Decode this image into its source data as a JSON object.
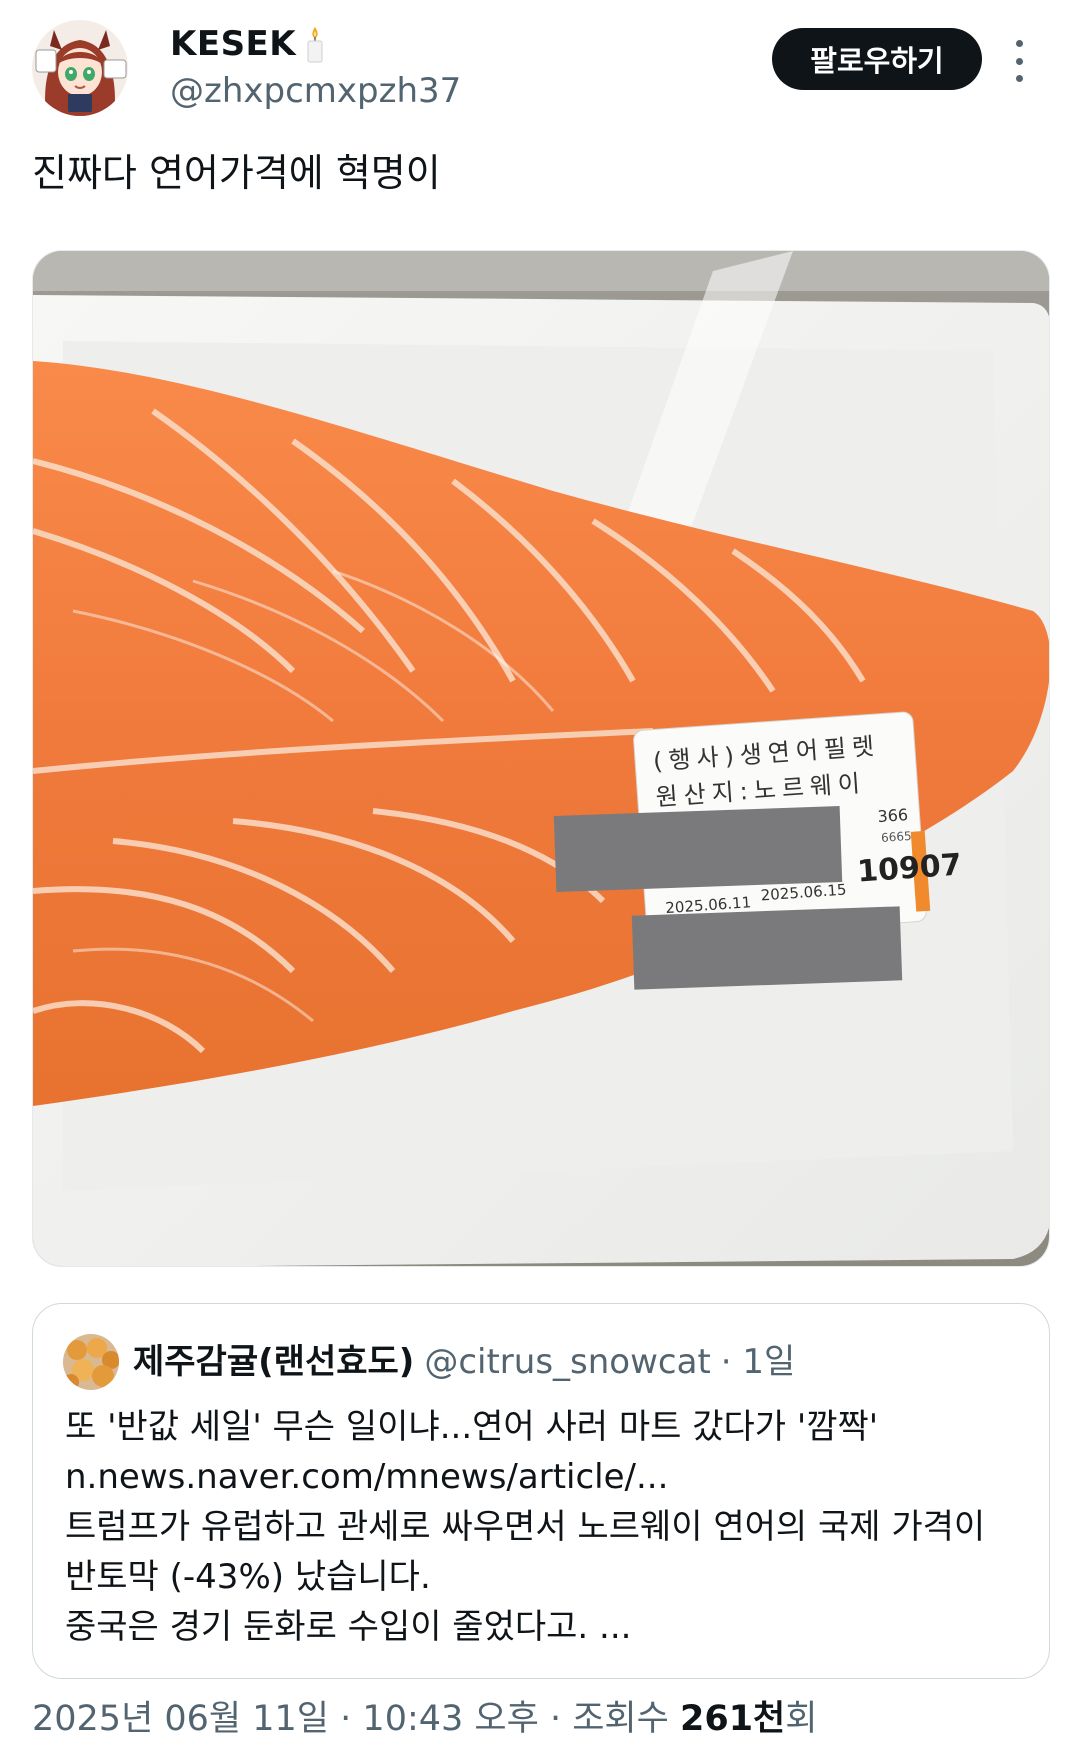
{
  "author": {
    "display_name": "KESEK",
    "handle": "@zhxpcmxpzh37"
  },
  "follow_label": "팔로우하기",
  "tweet_text": "진짜다 연어가격에 혁명이",
  "photo": {
    "label_line1": "(행사)생연어필렛",
    "label_line2": "원산지:노르웨이",
    "label_weight": "366",
    "label_code": "6665",
    "label_price": "10907",
    "label_date1": "2025.06.11",
    "label_date2": "2025.06.15"
  },
  "quote": {
    "name": "제주감귤(랜선효도)",
    "handle": "@citrus_snowcat",
    "time": "· 1일",
    "lines": [
      "또 '반값 세일' 무슨 일이냐...연어 사러 마트 갔다가 '깜짝'",
      "n.news.naver.com/mnews/article/...",
      "트럼프가 유럽하고 관세로 싸우면서 노르웨이 연어의 국제 가격이",
      "반토막 (-43%) 났습니다.",
      "중국은 경기 둔화로 수입이 줄었다고. ..."
    ]
  },
  "meta": {
    "date": "2025년 06월 11일",
    "time": "10:43 오후",
    "views_label": "조회수",
    "views_count": "261천",
    "views_suffix": "회",
    "separator": "·"
  },
  "colors": {
    "text_primary": "#0f1419",
    "text_secondary": "#536471",
    "border": "#cfd9de",
    "salmon": "#f07a3c"
  }
}
